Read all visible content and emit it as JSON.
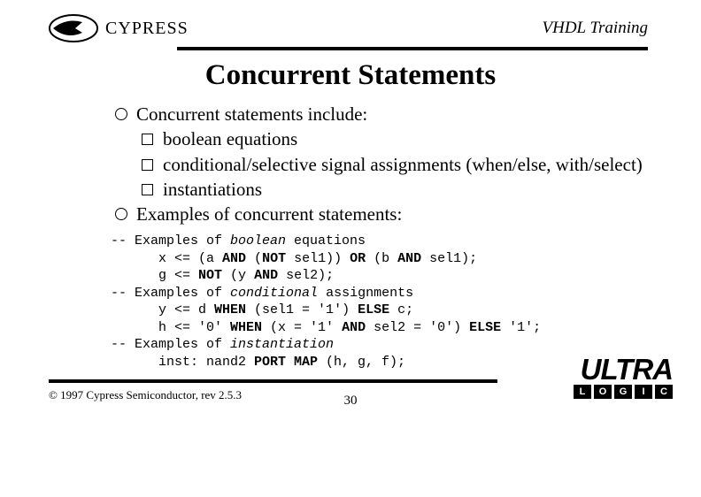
{
  "header": {
    "brand": "CYPRESS",
    "right": "VHDL Training"
  },
  "title": "Concurrent Statements",
  "bullets": {
    "b1": "Concurrent statements include:",
    "s1": "boolean equations",
    "s2": "conditional/selective signal assignments (when/else, with/select)",
    "s3": "instantiations",
    "b2": "Examples of concurrent statements:"
  },
  "code": {
    "c1a": "-- Examples of ",
    "c1b": "boolean",
    "c1c": " equations",
    "l2a": "      x <= (a ",
    "l2b": "AND",
    "l2c": " (",
    "l2d": "NOT",
    "l2e": " sel1)) ",
    "l2f": "OR",
    "l2g": " (b ",
    "l2h": "AND",
    "l2i": " sel1);",
    "l3a": "      g <= ",
    "l3b": "NOT",
    "l3c": " (y ",
    "l3d": "AND",
    "l3e": " sel2);",
    "c4a": "-- Examples of ",
    "c4b": "conditional",
    "c4c": " assignments",
    "l5a": "      y <= d ",
    "l5b": "WHEN",
    "l5c": " (sel1 = '1') ",
    "l5d": "ELSE",
    "l5e": " c;",
    "l6a": "      h <= '0' ",
    "l6b": "WHEN",
    "l6c": " (x = '1' ",
    "l6d": "AND",
    "l6e": " sel2 = '0') ",
    "l6f": "ELSE",
    "l6g": " '1';",
    "c7a": "-- Examples of ",
    "c7b": "instantiation",
    "l8a": "      inst: nand2 ",
    "l8b": "PORT MAP",
    "l8c": " (h, g, f);"
  },
  "footer": {
    "copyright": "© 1997 Cypress Semiconductor, rev 2.5.3",
    "page": "30",
    "ultra": "ULTRA",
    "logic": [
      "L",
      "O",
      "G",
      "I",
      "C"
    ]
  }
}
